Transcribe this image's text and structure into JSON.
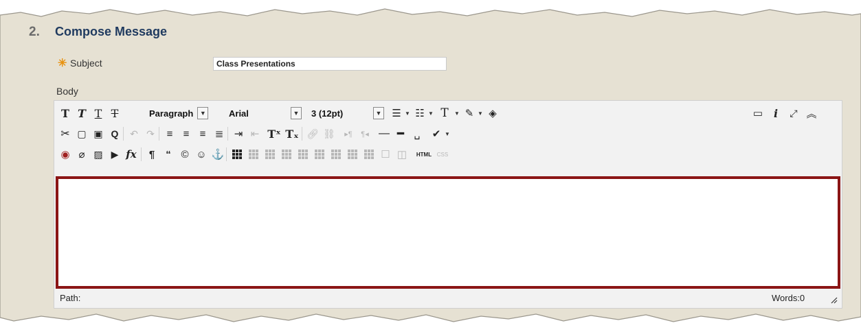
{
  "form": {
    "step_number": "2.",
    "step_title": "Compose Message",
    "required_marker": "✳",
    "subject_label": "Subject",
    "subject_value": "Class Presentations",
    "body_label": "Body"
  },
  "editor": {
    "paragraph_select": "Paragraph",
    "font_select": "Arial",
    "size_select": "3 (12pt)",
    "path_label": "Path:",
    "word_count": "Words:0",
    "html_label": "HTML",
    "css_label": "CSS",
    "accent_color": "#8b1515"
  }
}
